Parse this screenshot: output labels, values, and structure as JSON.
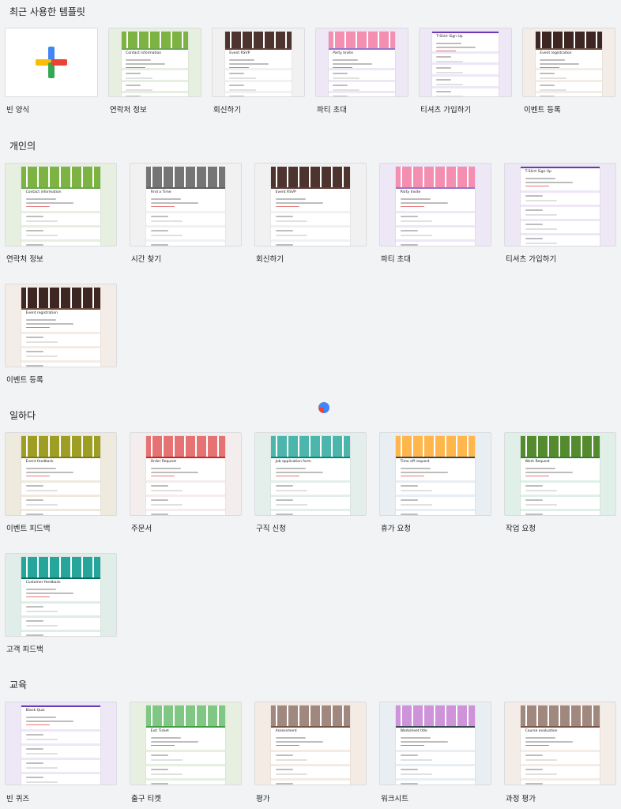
{
  "sections": {
    "recent": "최근 사용한 템플릿",
    "personal": "개인의",
    "work": "일하다",
    "education": "교육"
  },
  "recent": [
    {
      "label": "빈 양식",
      "title": "",
      "color": "#ffffff",
      "banner": "none"
    },
    {
      "label": "연락처 정보",
      "title": "Contact information",
      "color": "#e6efe0",
      "accent": "#6aa84f",
      "banner": "#7cb342"
    },
    {
      "label": "회신하기",
      "title": "Event RSVP",
      "color": "#f1f1f1",
      "accent": "#5d4037",
      "banner": "#4e342e"
    },
    {
      "label": "파티 초대",
      "title": "Party Invite",
      "color": "#ede7f6",
      "accent": "#9575cd",
      "banner": "#f48fb1"
    },
    {
      "label": "티셔츠 가입하기",
      "title": "T-Shirt Sign Up",
      "color": "#ede7f6",
      "accent": "#673ab7",
      "banner": "none"
    },
    {
      "label": "이벤트 등록",
      "title": "Event registration",
      "color": "#f4ece6",
      "accent": "#6d4c41",
      "banner": "#3e2723"
    }
  ],
  "personal": [
    {
      "label": "연락처 정보",
      "title": "Contact information",
      "color": "#e6efe0",
      "accent": "#6aa84f",
      "banner": "#7cb342"
    },
    {
      "label": "시간 찾기",
      "title": "Find a Time",
      "color": "#f1f1f1",
      "accent": "#616161",
      "banner": "#757575"
    },
    {
      "label": "회신하기",
      "title": "Event RSVP",
      "color": "#f1f1f1",
      "accent": "#5d4037",
      "banner": "#4e342e"
    },
    {
      "label": "파티 초대",
      "title": "Party Invite",
      "color": "#ede7f6",
      "accent": "#9575cd",
      "banner": "#f48fb1"
    },
    {
      "label": "티셔츠 가입하기",
      "title": "T-Shirt Sign Up",
      "color": "#ede7f6",
      "accent": "#673ab7",
      "banner": "none"
    },
    {
      "label": "이벤트 등록",
      "title": "Event registration",
      "color": "#f4ece6",
      "accent": "#6d4c41",
      "banner": "#3e2723"
    }
  ],
  "work": [
    {
      "label": "이벤트 피드백",
      "title": "Event feedback",
      "color": "#eeeade",
      "accent": "#827717",
      "banner": "#9e9d24"
    },
    {
      "label": "주문서",
      "title": "Order Request",
      "color": "#f3eded",
      "accent": "#c62828",
      "banner": "#e57373"
    },
    {
      "label": "구직 신청",
      "title": "Job application form",
      "color": "#e4efeb",
      "accent": "#00897b",
      "banner": "#4db6ac"
    },
    {
      "label": "휴가 요청",
      "title": "Time off request",
      "color": "#e8eef2",
      "accent": "#37474f",
      "banner": "#ffb74d"
    },
    {
      "label": "작업 요청",
      "title": "Work Request",
      "color": "#e0efe8",
      "accent": "#2e7d32",
      "banner": "#558b2f"
    },
    {
      "label": "고객 피드백",
      "title": "Customer feedback",
      "color": "#e0ede8",
      "accent": "#00695c",
      "banner": "#26a69a"
    }
  ],
  "education": [
    {
      "label": "빈 퀴즈",
      "title": "Blank Quiz",
      "color": "#ede7f6",
      "accent": "#673ab7",
      "banner": "none"
    },
    {
      "label": "출구 티켓",
      "title": "Exit Ticket",
      "color": "#e6efe0",
      "accent": "#43a047",
      "banner": "#81c784"
    },
    {
      "label": "평가",
      "title": "Assessment",
      "color": "#f3ebe4",
      "accent": "#795548",
      "banner": "#a1887f"
    },
    {
      "label": "워크시트",
      "title": "Worksheet title",
      "color": "#e8eef2",
      "accent": "#37474f",
      "banner": "#ce93d8"
    },
    {
      "label": "과정 평가",
      "title": "Course evaluation",
      "color": "#f4ece6",
      "accent": "#795548",
      "banner": "#a1887f"
    }
  ]
}
